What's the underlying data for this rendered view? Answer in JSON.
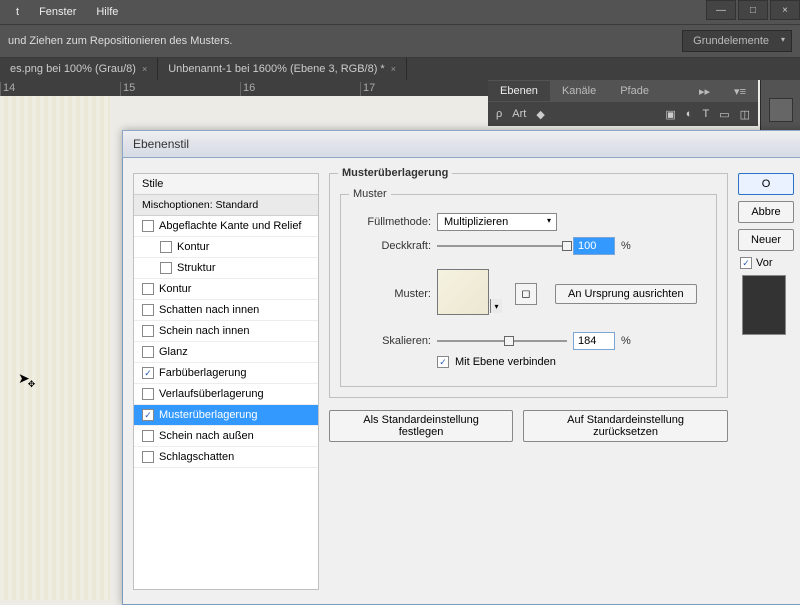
{
  "menu": {
    "items": [
      "t",
      "Fenster",
      "Hilfe"
    ]
  },
  "window_controls": {
    "min": "—",
    "max": "□",
    "close": "×"
  },
  "toolbar": {
    "hint": "und Ziehen zum Repositionieren des Musters.",
    "presets": "Grundelemente"
  },
  "doc_tabs": [
    "es.png bei 100% (Grau/8)",
    "Unbenannt-1 bei 1600% (Ebene 3, RGB/8) *"
  ],
  "panels": {
    "tabs": [
      "Ebenen",
      "Kanäle",
      "Pfade"
    ],
    "filter": "Art"
  },
  "ruler": {
    "ticks": [
      "14",
      "15",
      "16",
      "17"
    ]
  },
  "dialog": {
    "title": "Ebenenstil",
    "styles_header": "Stile",
    "blend_options": "Mischoptionen: Standard",
    "style_items": [
      {
        "label": "Abgeflachte Kante und Relief",
        "checked": false,
        "indent": 0
      },
      {
        "label": "Kontur",
        "checked": false,
        "indent": 1
      },
      {
        "label": "Struktur",
        "checked": false,
        "indent": 1
      },
      {
        "label": "Kontur",
        "checked": false,
        "indent": 0
      },
      {
        "label": "Schatten nach innen",
        "checked": false,
        "indent": 0
      },
      {
        "label": "Schein nach innen",
        "checked": false,
        "indent": 0
      },
      {
        "label": "Glanz",
        "checked": false,
        "indent": 0
      },
      {
        "label": "Farbüberlagerung",
        "checked": true,
        "indent": 0
      },
      {
        "label": "Verlaufsüberlagerung",
        "checked": false,
        "indent": 0
      },
      {
        "label": "Musterüberlagerung",
        "checked": true,
        "indent": 0,
        "selected": true
      },
      {
        "label": "Schein nach außen",
        "checked": false,
        "indent": 0
      },
      {
        "label": "Schlagschatten",
        "checked": false,
        "indent": 0
      }
    ],
    "main": {
      "group_title": "Musterüberlagerung",
      "inner_title": "Muster",
      "blend_label": "Füllmethode:",
      "blend_value": "Multiplizieren",
      "opacity_label": "Deckkraft:",
      "opacity_value": "100",
      "pattern_label": "Muster:",
      "snap_origin": "An Ursprung ausrichten",
      "scale_label": "Skalieren:",
      "scale_value": "184",
      "link_layer": "Mit Ebene verbinden",
      "percent": "%"
    },
    "footer": {
      "make_default": "Als Standardeinstellung festlegen",
      "reset_default": "Auf Standardeinstellung zurücksetzen"
    },
    "right": {
      "ok": "O",
      "cancel": "Abbre",
      "new_style": "Neuer",
      "preview": "Vor"
    }
  }
}
